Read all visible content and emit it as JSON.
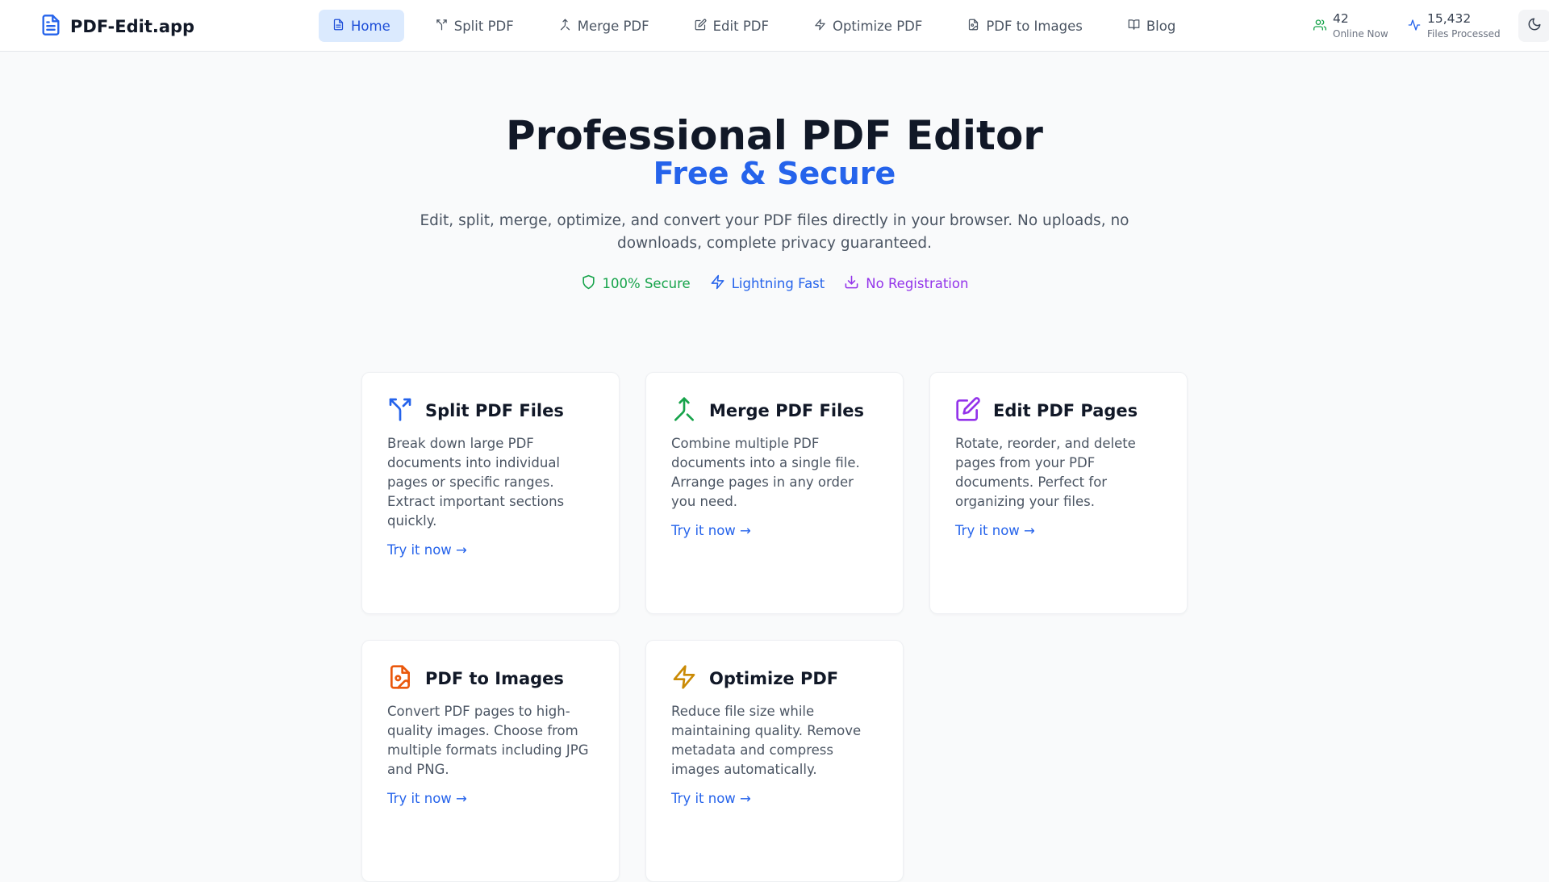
{
  "brand": {
    "name": "PDF-Edit.app",
    "logo_icon": "file-text-icon"
  },
  "nav": {
    "items": [
      {
        "label": "Home",
        "icon": "file-icon",
        "active": true
      },
      {
        "label": "Split PDF",
        "icon": "split-icon"
      },
      {
        "label": "Merge PDF",
        "icon": "merge-icon"
      },
      {
        "label": "Edit PDF",
        "icon": "edit-icon"
      },
      {
        "label": "Optimize PDF",
        "icon": "zap-icon"
      },
      {
        "label": "PDF to Images",
        "icon": "file-image-icon"
      },
      {
        "label": "Blog",
        "icon": "book-open-icon"
      }
    ]
  },
  "stats": {
    "online": {
      "value": "42",
      "label": "Online Now",
      "icon": "users-icon",
      "color": "#16a34a"
    },
    "processed": {
      "value": "15,432",
      "label": "Files Processed",
      "icon": "activity-icon",
      "color": "#2563eb"
    }
  },
  "theme_toggle": {
    "icon": "moon-icon"
  },
  "hero": {
    "title": "Professional PDF Editor",
    "subtitle": "Free & Secure",
    "description": "Edit, split, merge, optimize, and convert your PDF files directly in your browser. No uploads, no downloads, complete privacy guaranteed.",
    "badges": [
      {
        "label": "100% Secure",
        "icon": "shield-icon",
        "color": "#16a34a"
      },
      {
        "label": "Lightning Fast",
        "icon": "zap-icon",
        "color": "#2563eb"
      },
      {
        "label": "No Registration",
        "icon": "download-icon",
        "color": "#9333ea"
      }
    ]
  },
  "cards": [
    {
      "title": "Split PDF Files",
      "icon": "split-icon",
      "color": "#2563eb",
      "description": "Break down large PDF documents into individual pages or specific ranges. Extract important sections quickly.",
      "link": "Try it now →"
    },
    {
      "title": "Merge PDF Files",
      "icon": "merge-icon",
      "color": "#16a34a",
      "description": "Combine multiple PDF documents into a single file. Arrange pages in any order you need.",
      "link": "Try it now →"
    },
    {
      "title": "Edit PDF Pages",
      "icon": "edit-icon",
      "color": "#9333ea",
      "description": "Rotate, reorder, and delete pages from your PDF documents. Perfect for organizing your files.",
      "link": "Try it now →"
    },
    {
      "title": "PDF to Images",
      "icon": "file-image-icon",
      "color": "#ea580c",
      "description": "Convert PDF pages to high-quality images. Choose from multiple formats including JPG and PNG.",
      "link": "Try it now →"
    },
    {
      "title": "Optimize PDF",
      "icon": "zap-icon",
      "color": "#ca8a04",
      "description": "Reduce file size while maintaining quality. Remove metadata and compress images automatically.",
      "link": "Try it now →"
    }
  ],
  "colors": {
    "accent": "#2563eb",
    "nav_active_bg": "#dbeafe",
    "page_bg": "#f9fafb"
  }
}
